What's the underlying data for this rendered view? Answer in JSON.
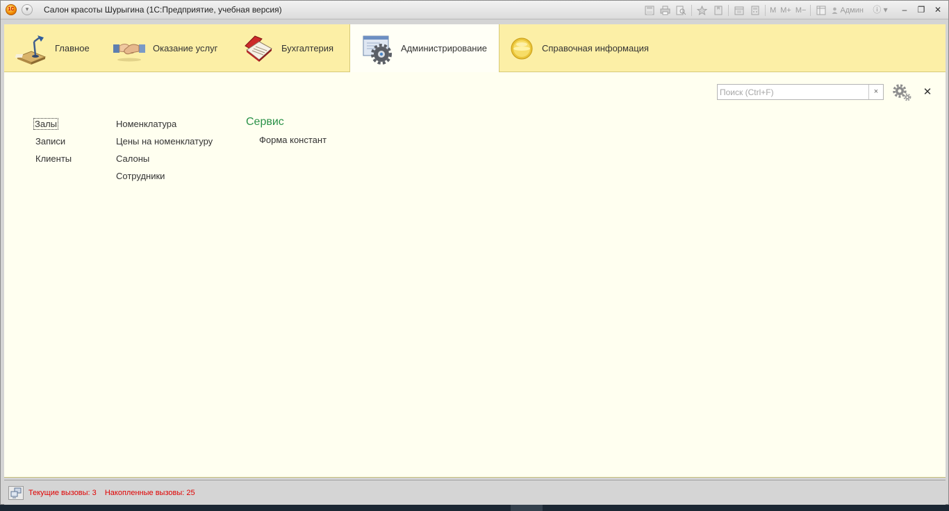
{
  "window": {
    "title": "Салон красоты Шурыгина  (1С:Предприятие, учебная версия)",
    "logo_text": "1С"
  },
  "toolbar": {
    "mem_m": "M",
    "mem_mplus": "M+",
    "mem_mminus": "M−",
    "user": "Админ"
  },
  "sections": [
    {
      "label": "Главное",
      "icon": "desk-lamp-icon"
    },
    {
      "label": "Оказание услуг",
      "icon": "handshake-icon"
    },
    {
      "label": "Бухгалтерия",
      "icon": "ledger-book-icon"
    },
    {
      "label": "Администрирование",
      "icon": "admin-gear-icon",
      "active": true
    },
    {
      "label": "Справочная информация",
      "icon": "info-disc-icon"
    }
  ],
  "search": {
    "placeholder": "Поиск (Ctrl+F)",
    "value": ""
  },
  "commands": {
    "col1": [
      "Залы",
      "Записи",
      "Клиенты"
    ],
    "col2": [
      "Номенклатура",
      "Цены на номенклатуру",
      "Салоны",
      "Сотрудники"
    ],
    "service": {
      "title": "Сервис",
      "items": [
        "Форма констант"
      ]
    }
  },
  "status": {
    "current_calls": "Текущие вызовы: 3",
    "accumulated_calls": "Накопленные вызовы: 25"
  },
  "colors": {
    "section_bar": "#fcefa6",
    "content_bg": "#fffff0",
    "group_title": "#2a9148",
    "status_text": "#e00000"
  }
}
